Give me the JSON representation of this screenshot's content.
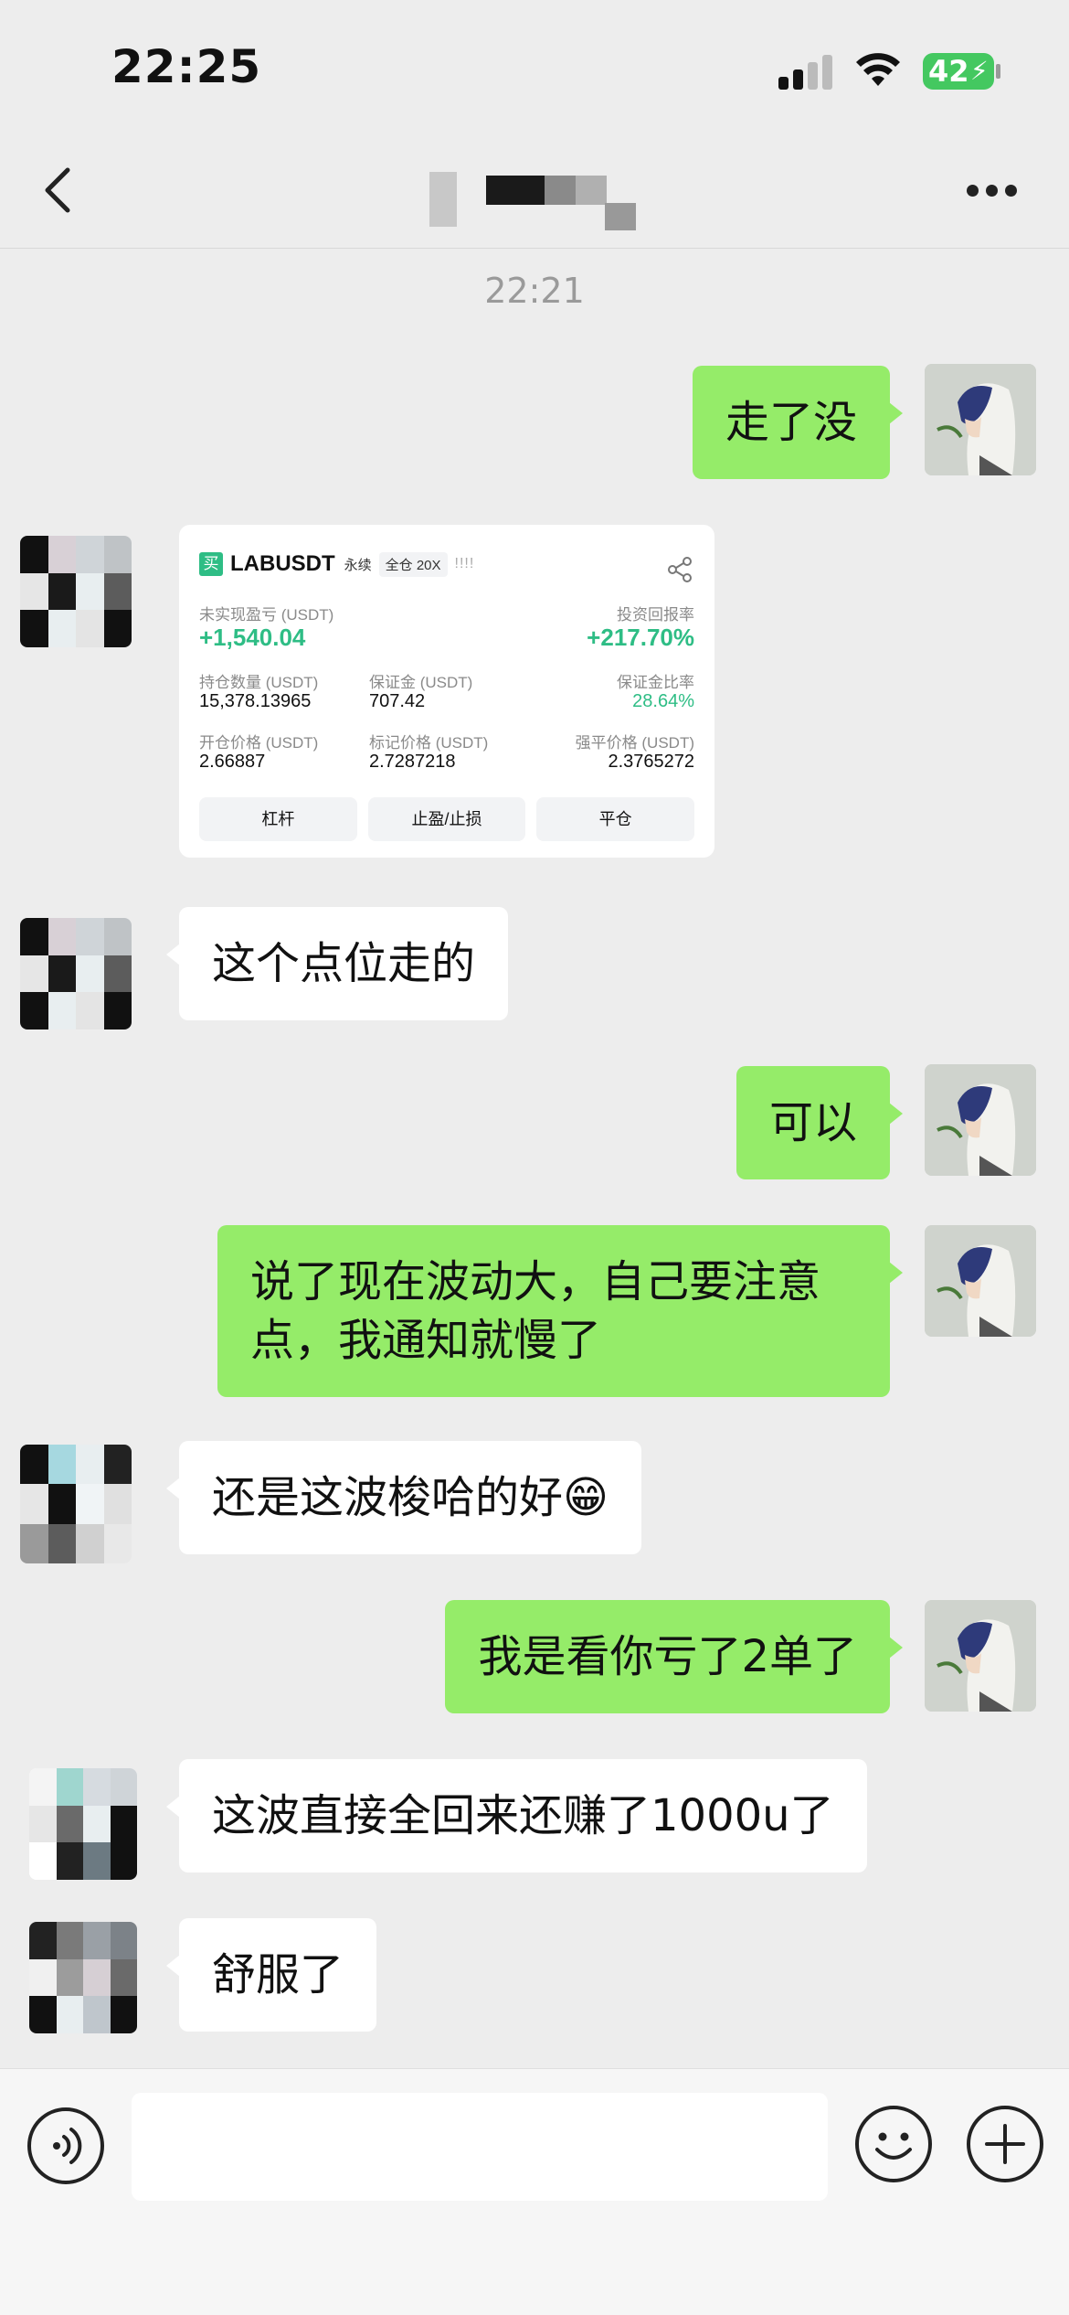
{
  "status_bar": {
    "time": "22:25",
    "battery": "42"
  },
  "chat": {
    "timestamp": "22:21"
  },
  "messages": [
    {
      "sender": "self",
      "text": "走了没"
    },
    {
      "sender": "other",
      "type": "trade_card"
    },
    {
      "sender": "other",
      "text": "这个点位走的"
    },
    {
      "sender": "self",
      "text": "可以"
    },
    {
      "sender": "self",
      "text": "说了现在波动大，自己要注意点，我通知就慢了"
    },
    {
      "sender": "other",
      "text": "还是这波梭哈的好😁"
    },
    {
      "sender": "self",
      "text": "我是看你亏了2单了"
    },
    {
      "sender": "other",
      "text": "这波直接全回来还赚了1000u了"
    },
    {
      "sender": "other",
      "text": "舒服了"
    }
  ],
  "trade_card": {
    "side": "买",
    "symbol": "LABUSDT",
    "tag_perpetual": "永续",
    "tag_margin": "全仓 20X",
    "bars": "!!!!",
    "unrealized_pnl_label": "未实现盈亏 (USDT)",
    "unrealized_pnl": "+1,540.04",
    "roi_label": "投资回报率",
    "roi": "+217.70%",
    "position_size_label": "持仓数量 (USDT)",
    "position_size": "15,378.13965",
    "margin_label": "保证金 (USDT)",
    "margin": "707.42",
    "margin_ratio_label": "保证金比率",
    "margin_ratio": "28.64%",
    "entry_price_label": "开仓价格 (USDT)",
    "entry_price": "2.66887",
    "mark_price_label": "标记价格 (USDT)",
    "mark_price": "2.7287218",
    "liq_price_label": "强平价格 (USDT)",
    "liq_price": "2.3765272",
    "btn_leverage": "杠杆",
    "btn_tpsl": "止盈/止损",
    "btn_close": "平仓"
  },
  "colors": {
    "self_bubble": "#95ec69",
    "other_bubble": "#ffffff",
    "background": "#ededed",
    "profit_green": "#2ebd85"
  }
}
